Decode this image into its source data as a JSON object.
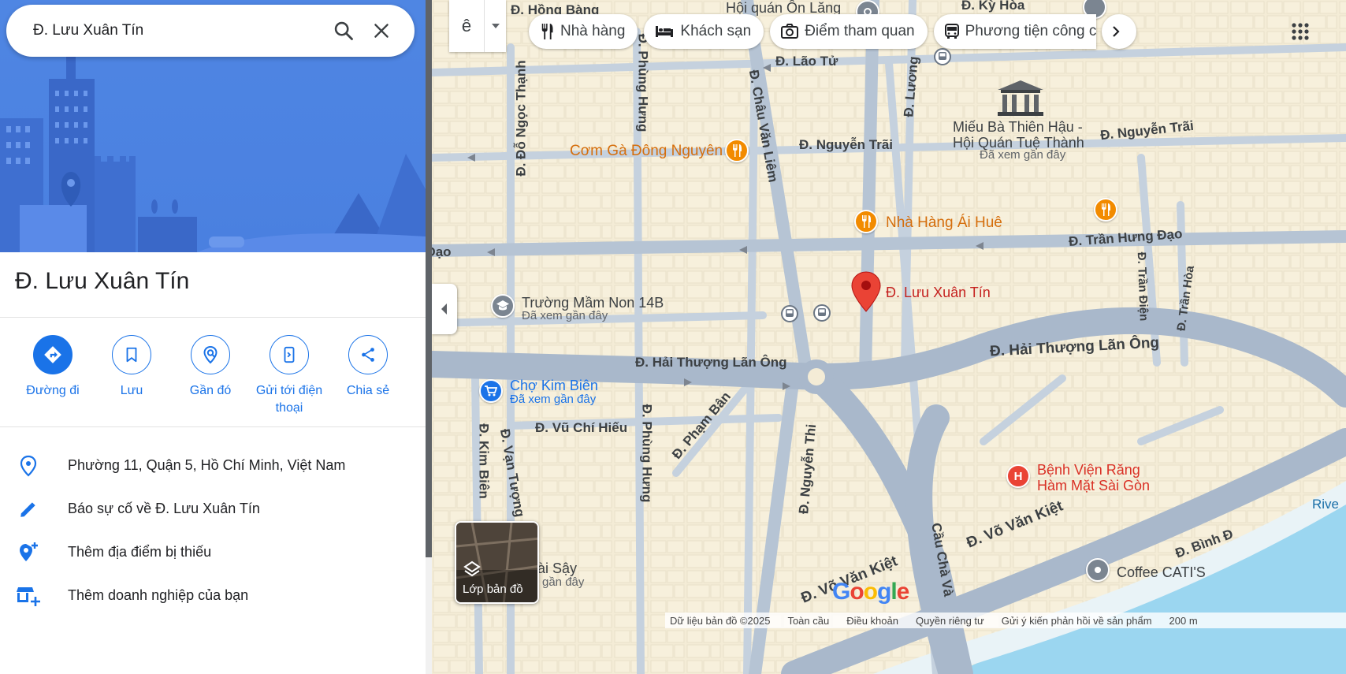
{
  "search": {
    "query": "Đ. Lưu Xuân Tín"
  },
  "place": {
    "title": "Đ. Lưu Xuân Tín"
  },
  "actions": [
    {
      "label": "Đường đi"
    },
    {
      "label": "Lưu"
    },
    {
      "label": "Gần đó"
    },
    {
      "label": "Gửi tới điện thoại"
    },
    {
      "label": "Chia sẻ"
    }
  ],
  "info": [
    {
      "text": "Phường 11, Quận 5, Hồ Chí Minh, Việt Nam",
      "icon": "location-pin-icon"
    },
    {
      "text": "Báo sự cố về Đ. Lưu Xuân Tín",
      "icon": "pencil-icon"
    },
    {
      "text": "Thêm địa điểm bị thiếu",
      "icon": "add-location-icon"
    },
    {
      "text": "Thêm doanh nghiệp của bạn",
      "icon": "add-business-icon"
    }
  ],
  "map": {
    "lang_button": "ê",
    "chips": [
      {
        "label": "Nhà hàng",
        "icon": "fork-knife-icon"
      },
      {
        "label": "Khách sạn",
        "icon": "bed-icon"
      },
      {
        "label": "Điểm tham quan",
        "icon": "camera-icon"
      },
      {
        "label": "Phương tiện công c",
        "icon": "bus-icon"
      }
    ],
    "layers_label": "Lớp bản đồ",
    "pin_label": "Đ. Lưu Xuân Tín",
    "streets": {
      "hong_bang": "Đ. Hồng Bàng",
      "lao_tu": "Đ. Lão Tử",
      "nguyen_trai_1": "Đ. Nguyễn Trãi",
      "nguyen_trai_2": "Đ. Nguyễn Trãi",
      "tran_hung_dao_left": "Đ. Trần Hưng Đạo",
      "tran_hung_dao_right": "Đ. Trần Hưng Đạo",
      "hai_thuong_lan_ong_1": "Đ. Hải Thượng Lãn Ông",
      "hai_thuong_lan_ong_2": "Đ. Hải Thượng Lãn Ông",
      "vu_chi_hieu": "Đ. Vũ Chí Hiếu",
      "pham_ban": "Đ. Phạm Bân",
      "do_ngoc_thanh": "Đ. Đỗ Ngọc Thạnh",
      "phung_hung_top": "Đ. Phùng Hưng",
      "phung_hung_bottom": "Đ. Phùng Hưng",
      "chau_van_liem": "Đ. Châu Văn Liêm",
      "luong": "Đ. Lương",
      "kim_bien": "Đ. Kim Biên",
      "van_tuong": "Đ. Vạn Tượng",
      "nguyen_thi": "Đ. Nguyễn Thi",
      "tran_dien": "Đ. Trần Điện",
      "tran_hoa": "Đ. Trần Hòa",
      "vo_van_kiet_1": "Đ. Võ Văn Kiệt",
      "vo_van_kiet_2": "Đ. Võ Văn Kiệt",
      "cau_cha_va": "Cầu Chà Và",
      "binh_dong": "Đ. Bình Đ"
    },
    "places": {
      "hoi_quan": "Hội quán Ôn Lăng",
      "ky_hoa": "Đ. Kỳ Hòa",
      "com_ga": "Cơm Gà Đông Nguyên",
      "mieu_line1": "Miếu Bà Thiên Hậu -",
      "mieu_line2": "Hội Quán Tuệ Thành",
      "mieu_sub": "Đã xem gần đây",
      "ai_hue": "Nhà Hàng Ái Huê",
      "truong_mam_non": "Trường Mầm Non 14B",
      "truong_sub": "Đã xem gần đây",
      "cho_kim_bien": "Chợ Kim Biên",
      "cho_sub": "Đã xem gần đây",
      "benh_vien_1": "Bệnh Viện Răng",
      "benh_vien_2": "Hàm Mặt Sài Gòn",
      "coffee": "Coffee CATI'S",
      "river": "Rive",
      "sai_say": "ài Sậy",
      "sai_say_sub": "gần đây"
    },
    "logo": "Google",
    "footer": [
      "Dữ liệu bản đồ ©2025",
      "Toàn cầu",
      "Điều khoản",
      "Quyền riêng tư",
      "Gửi ý kiến phản hồi về sản phẩm",
      "200 m"
    ]
  },
  "colors": {
    "accent": "#1a73e8",
    "pin": "#ea4335",
    "food": "#f28b00",
    "water": "#9bd6f0",
    "road": "#a9b8cb"
  }
}
